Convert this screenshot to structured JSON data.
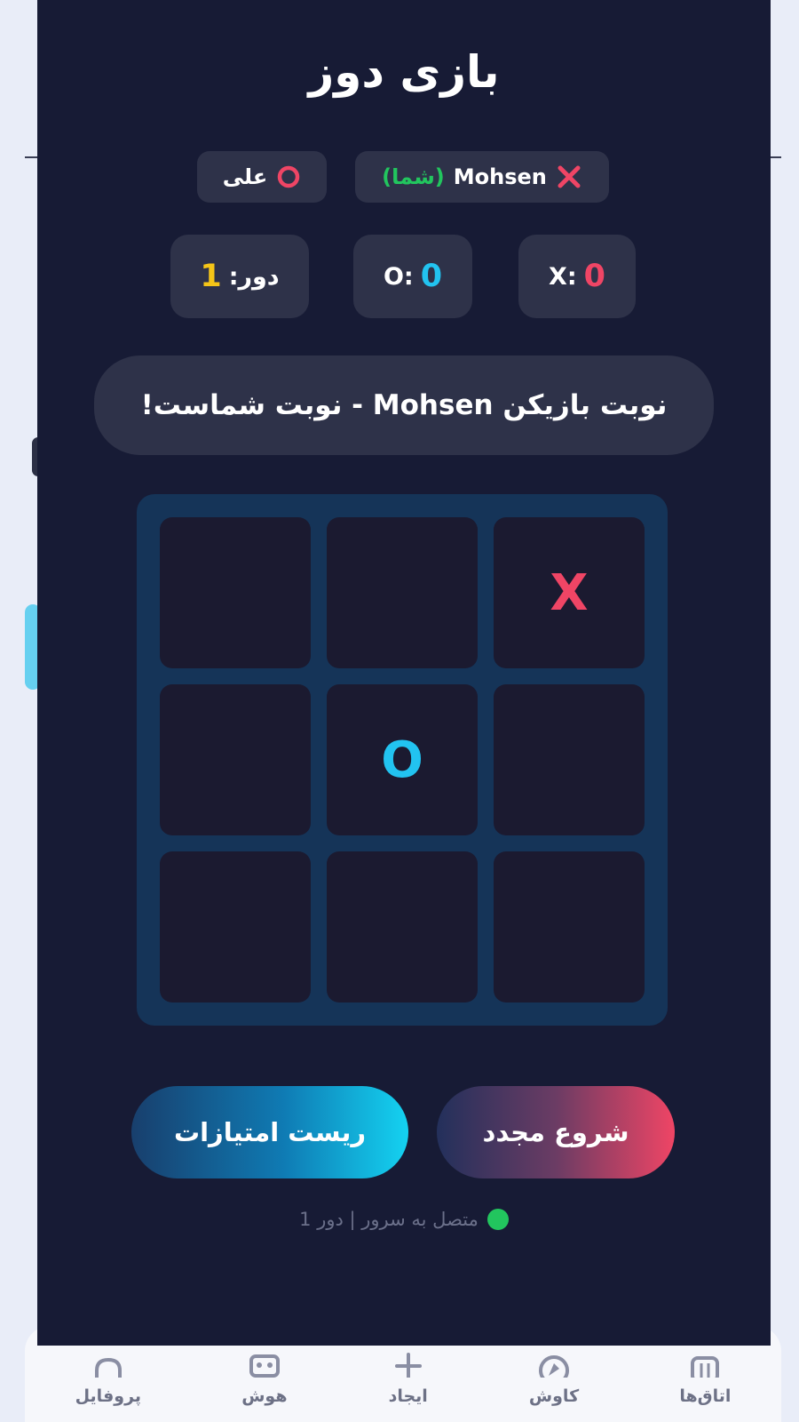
{
  "colors": {
    "panel_bg": "#171b35",
    "card_bg": "#2e3249",
    "board_bg": "#153458",
    "cell_bg": "#1b1a30",
    "x_color": "#ef4565",
    "o_color": "#22c3f0",
    "round_color": "#f5c518",
    "online_color": "#22c55e"
  },
  "header": {
    "title": "بازی دوز"
  },
  "players": {
    "x": {
      "name": "Mohsen",
      "you_tag": "(شما)",
      "icon": "x-icon"
    },
    "o": {
      "name": "علی",
      "icon": "o-ring-icon"
    }
  },
  "scores": {
    "x_label": "X:",
    "x_value": "0",
    "o_label": "O:",
    "o_value": "0",
    "round_label": "دور:",
    "round_value": "1"
  },
  "turn": {
    "message": "نوبت بازیکن Mohsen - نوبت شماست!"
  },
  "board": {
    "cells": [
      "X",
      "",
      "",
      "",
      "O",
      "",
      "",
      "",
      ""
    ]
  },
  "buttons": {
    "restart": "شروع مجدد",
    "reset_scores": "ریست امتیازات"
  },
  "status": {
    "text": "متصل به سرور | دور 1"
  },
  "nav": {
    "items": [
      {
        "label": "اتاق‌ها",
        "icon": "rooms-icon"
      },
      {
        "label": "کاوش",
        "icon": "explore-icon"
      },
      {
        "label": "ایجاد",
        "icon": "plus-icon"
      },
      {
        "label": "هوش",
        "icon": "robot-icon"
      },
      {
        "label": "پروفایل",
        "icon": "profile-icon"
      }
    ]
  }
}
